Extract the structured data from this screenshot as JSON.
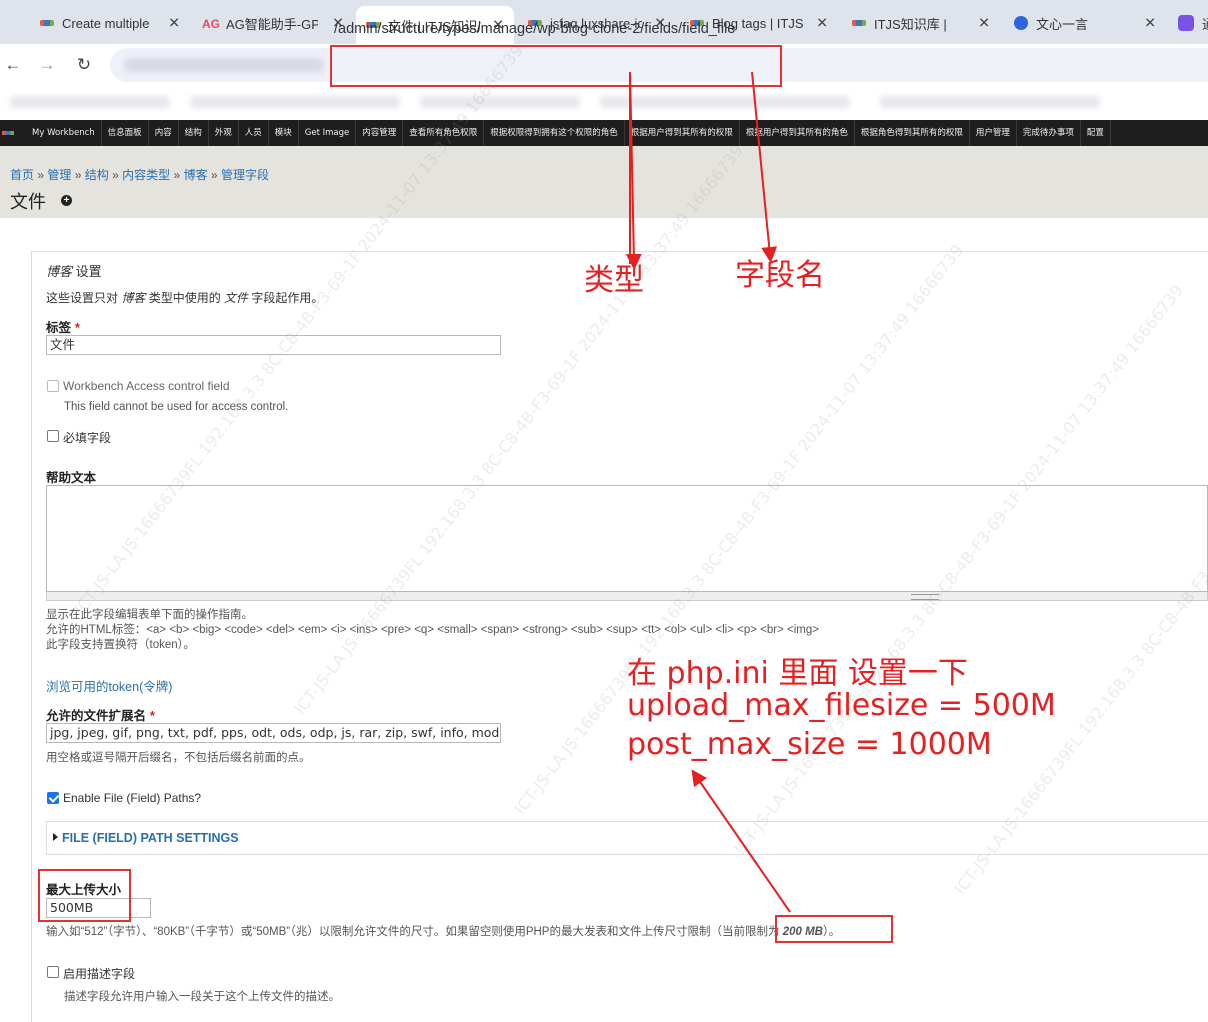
{
  "browser": {
    "tabs": [
      {
        "title": "Create multiple"
      },
      {
        "title": "AG智能助手-GPT"
      },
      {
        "title": "文件 | ITJS知识库"
      },
      {
        "title": "jsfaq.luxshare-ic"
      },
      {
        "title": "Blog tags | ITJS"
      },
      {
        "title": "ITJS知识库 |"
      },
      {
        "title": "文心一言"
      },
      {
        "title": "通"
      }
    ],
    "url": "/admin/structure/types/manage/wp-blog-clone-2/fields/field_file"
  },
  "toolbar": {
    "items": [
      "My Workbench",
      "信息面板",
      "内容",
      "结构",
      "外观",
      "人员",
      "模块",
      "Get Image",
      "内容管理",
      "查看所有角色权限",
      "根据权限得到拥有这个权限的角色",
      "根据用户得到其所有的权限",
      "根据用户得到其所有的角色",
      "根据角色得到其所有的权限",
      "用户管理",
      "完成待办事项",
      "配置"
    ]
  },
  "breadcrumb": {
    "items": [
      "首页",
      "管理",
      "结构",
      "内容类型",
      "博客",
      "管理字段"
    ],
    "separator": "»"
  },
  "page": {
    "title": "文件"
  },
  "form": {
    "section_title_type": "博客",
    "section_title_suffix": " 设置",
    "section_desc_1": "这些设置只对 ",
    "section_desc_type": "博客",
    "section_desc_2": " 类型中使用的 ",
    "section_desc_field": "文件",
    "section_desc_3": " 字段起作用。",
    "label_label": "标签",
    "label_value": "文件",
    "workbench_label": "Workbench Access control field",
    "workbench_desc": "This field cannot be used for access control.",
    "required_label": "必填字段",
    "help_label": "帮助文本",
    "help_desc_1": "显示在此字段编辑表单下面的操作指南。",
    "help_desc_2": "允许的HTML标签：<a> <b> <big> <code> <del> <em> <i> <ins> <pre> <q> <small> <span> <strong> <sub> <sup> <tt> <ol> <ul> <li> <p> <br> <img>",
    "help_desc_3": "此字段支持置换符（token）。",
    "token_link": "浏览可用的token(令牌)",
    "ext_label": "允许的文件扩展名",
    "ext_value": "jpg, jpeg, gif, png, txt, pdf, pps, odt, ods, odp, js, rar, zip, swf, info, module, a",
    "ext_desc": "用空格或逗号隔开后缀名，不包括后缀名前面的点。",
    "paths_label": "Enable File (Field) Paths?",
    "paths_checked": true,
    "paths_fieldset": "FILE (FIELD) PATH SETTINGS",
    "maxsize_label": "最大上传大小",
    "maxsize_value": "500MB",
    "maxsize_desc_1": "输入如“512”（字节）、“80KB”（千字节）或“50MB”（兆）以限制允许文件的尺寸。如果留空则使用PHP的最大发表和文件上传尺寸限制（",
    "maxsize_desc_limit_prefix": "当前限制为 ",
    "maxsize_desc_limit_value": "200 MB",
    "maxsize_desc_2": "）。",
    "desc_field_label": "启用描述字段",
    "desc_field_desc": "描述字段允许用户输入一段关于这个上传文件的描述。"
  },
  "annotations": {
    "type_label": "类型",
    "field_name_label": "字段名",
    "php_note_line1": "在 php.ini 里面 设置一下",
    "php_note_line2": "upload_max_filesize = 500M",
    "php_note_line3": "post_max_size = 1000M",
    "color": "#e62020"
  },
  "watermark": {
    "text": "ICT-JS-LA  JS-16666739FL  192.168.3.3  8C-C8-4B-F3-69-1F  2024-11-07  13:37:49  16666739"
  },
  "colors": {
    "toolbar_bg": "#1e1e1e",
    "header_bg": "#e5e3dd",
    "link": "#2a6fb0",
    "annotation_red": "#e62020"
  }
}
